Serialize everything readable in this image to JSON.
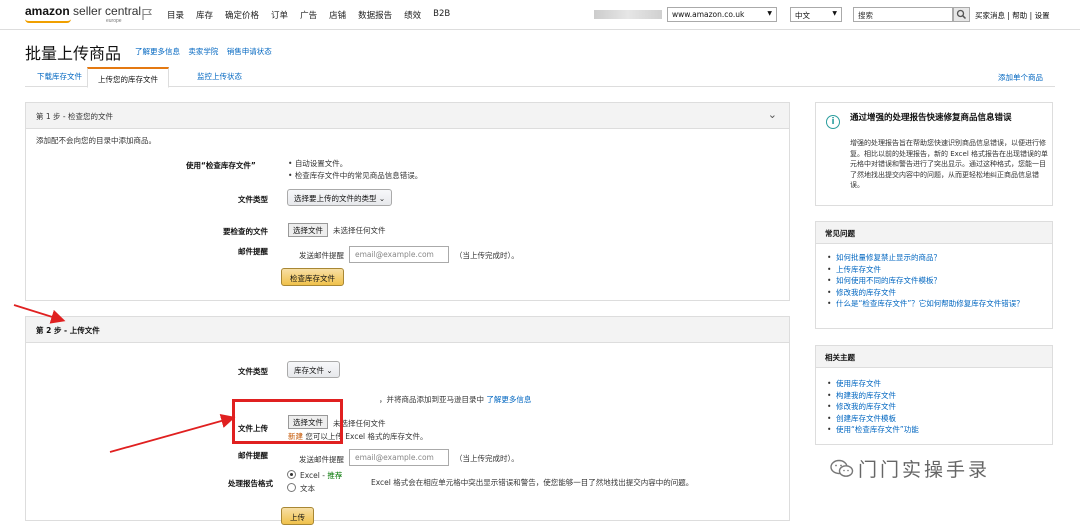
{
  "header": {
    "logo_main": "amazon",
    "logo_sub": "seller central",
    "logo_region": "europe",
    "nav": [
      "目录",
      "库存",
      "确定价格",
      "订单",
      "广告",
      "店铺",
      "数据报告",
      "绩效",
      "B2B"
    ],
    "marketplace": "www.amazon.co.uk",
    "language": "中文",
    "search_placeholder": "搜索",
    "links": "买家消息 | 帮助 | 设置"
  },
  "page": {
    "title": "批量上传商品",
    "title_links": [
      "了解更多信息",
      "卖家学院",
      "销售申请状态"
    ]
  },
  "tabs": {
    "items": [
      "下载库存文件",
      "上传您的库存文件",
      "监控上传状态"
    ],
    "right_link": "添加单个商品"
  },
  "step1": {
    "header": "第 1 步 - 检查您的文件",
    "intro": "添加配不会向您的目录中添加商品。",
    "use_label": "使用“检查库存文件”",
    "bullets": [
      "自动设置文件。",
      "检查库存文件中的常见商品信息错误。"
    ],
    "file_type_label": "文件类型",
    "file_type_value": "选择要上传的文件的类型",
    "file_label": "要检查的文件",
    "choose_file": "选择文件",
    "no_file": "未选择任何文件",
    "email_label": "邮件提醒",
    "email_prefix": "发送邮件提醒",
    "email_placeholder": "email@example.com",
    "email_suffix": "（当上传完成时）。",
    "button": "检查库存文件"
  },
  "step2": {
    "header": "第 2 步 - 上传文件",
    "file_type_label": "文件类型",
    "file_type_value": "库存文件",
    "desc_tail": "，并将商品添加到亚马逊目录中",
    "desc_link": "了解更多信息",
    "upload_label": "文件上传",
    "choose_file": "选择文件",
    "no_file": "未选择任何文件",
    "new_badge": "新建",
    "upload_hint": "您可以上传 Excel 格式的库存文件。",
    "email_label": "邮件提醒",
    "email_prefix": "发送邮件提醒",
    "email_placeholder": "email@example.com",
    "email_suffix": "（当上传完成时）。",
    "report_label": "处理报告格式",
    "option_excel": "Excel - ",
    "option_excel_tag": "推荐",
    "option_text": "文本",
    "report_desc": "Excel 格式会在相应单元格中突出显示错误和警告，使您能够一目了然地找出提交内容中的问题。",
    "button": "上传"
  },
  "sidebar": {
    "notice_title": "通过增强的处理报告快速修复商品信息错误",
    "notice_body": "增强的处理报告旨在帮助您快速识别商品信息错误，以便进行修复。相比以前的处理报告，新的 Excel 格式报告在出现错误的单元格中对错误和警告进行了突出显示。通过这种格式，您能一目了然地找出提交内容中的问题，从而更轻松地纠正商品信息错误。",
    "faq_title": "常见问题",
    "faq_items": [
      "如何批量修复禁止显示的商品？",
      "上传库存文件",
      "如何使用不同的库存文件模板？",
      "修改我的库存文件",
      "什么是“检查库存文件”？它如何帮助修复库存文件错误？"
    ],
    "topics_title": "相关主题",
    "topics_items": [
      "使用库存文件",
      "构建我的库存文件",
      "修改我的库存文件",
      "创建库存文件模板",
      "使用“检查库存文件”功能"
    ]
  },
  "watermark": {
    "text": "门门实操手录"
  },
  "colors": {
    "accent": "#e47911",
    "link": "#0066c0",
    "annotation": "#e02020",
    "button": "#f0c14b"
  }
}
